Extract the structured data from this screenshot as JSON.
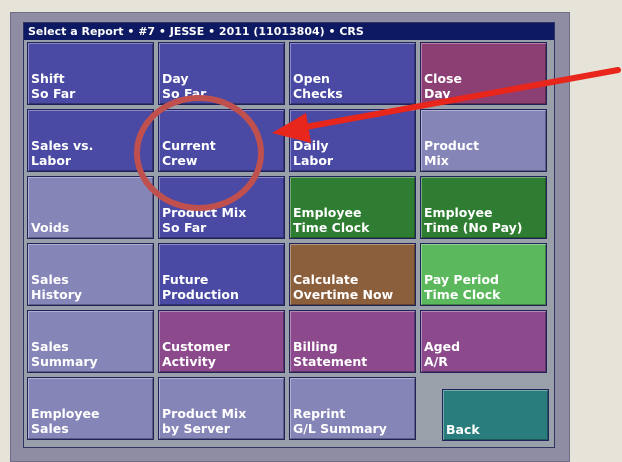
{
  "title": "Select a Report • #7 • JESSE • 2011 (11013804) • CRS",
  "tiles": [
    {
      "line1": "Shift",
      "line2": "So Far",
      "color": "#4a4aa4",
      "name": "shift-so-far-button"
    },
    {
      "line1": "Day",
      "line2": "So Far",
      "color": "#4a4aa4",
      "name": "day-so-far-button"
    },
    {
      "line1": "Open",
      "line2": "Checks",
      "color": "#4a4aa4",
      "name": "open-checks-button"
    },
    {
      "line1": "Close",
      "line2": "Day",
      "color": "#8c3f72",
      "name": "close-day-button"
    },
    {
      "line1": "Sales vs.",
      "line2": "Labor",
      "color": "#4a4aa4",
      "name": "sales-vs-labor-button"
    },
    {
      "line1": "Current",
      "line2": "Crew",
      "color": "#4a4aa4",
      "name": "current-crew-button"
    },
    {
      "line1": "Daily",
      "line2": "Labor",
      "color": "#4a4aa4",
      "name": "daily-labor-button"
    },
    {
      "line1": "Product",
      "line2": "Mix",
      "color": "#8585b8",
      "name": "product-mix-button"
    },
    {
      "line1": "",
      "line2": "Voids",
      "color": "#8585b8",
      "name": "voids-button"
    },
    {
      "line1": "Product Mix",
      "line2": "So Far",
      "color": "#4a4aa4",
      "name": "product-mix-so-far-button"
    },
    {
      "line1": "Employee",
      "line2": "Time Clock",
      "color": "#2e7d32",
      "name": "employee-time-clock-button"
    },
    {
      "line1": "Employee",
      "line2": "Time (No Pay)",
      "color": "#2e7d32",
      "name": "employee-time-no-pay-button"
    },
    {
      "line1": "Sales",
      "line2": "History",
      "color": "#8585b8",
      "name": "sales-history-button"
    },
    {
      "line1": "Future",
      "line2": "Production",
      "color": "#4a4aa4",
      "name": "future-production-button"
    },
    {
      "line1": "Calculate",
      "line2": "Overtime Now",
      "color": "#8b5e3c",
      "name": "calculate-overtime-now-button"
    },
    {
      "line1": "Pay Period",
      "line2": "Time Clock",
      "color": "#5cb85c",
      "name": "pay-period-time-clock-button"
    },
    {
      "line1": "Sales",
      "line2": "Summary",
      "color": "#8585b8",
      "name": "sales-summary-button"
    },
    {
      "line1": "Customer",
      "line2": "Activity",
      "color": "#8c4a8c",
      "name": "customer-activity-button"
    },
    {
      "line1": "Billing",
      "line2": "Statement",
      "color": "#8c4a8c",
      "name": "billing-statement-button"
    },
    {
      "line1": "Aged",
      "line2": "A/R",
      "color": "#8c4a8c",
      "name": "aged-ar-button"
    },
    {
      "line1": "Employee",
      "line2": "Sales",
      "color": "#8585b8",
      "name": "employee-sales-button"
    },
    {
      "line1": "Product Mix",
      "line2": "by Server",
      "color": "#8585b8",
      "name": "product-mix-by-server-button"
    },
    {
      "line1": "Reprint",
      "line2": "G/L Summary",
      "color": "#8585b8",
      "name": "reprint-gl-summary-button"
    },
    {
      "line1": "",
      "line2": "Back",
      "color": "#2a7d7d",
      "name": "back-button"
    }
  ],
  "annotation": {
    "arrow_color": "#e8261c",
    "circle_color": "#c0504d"
  }
}
